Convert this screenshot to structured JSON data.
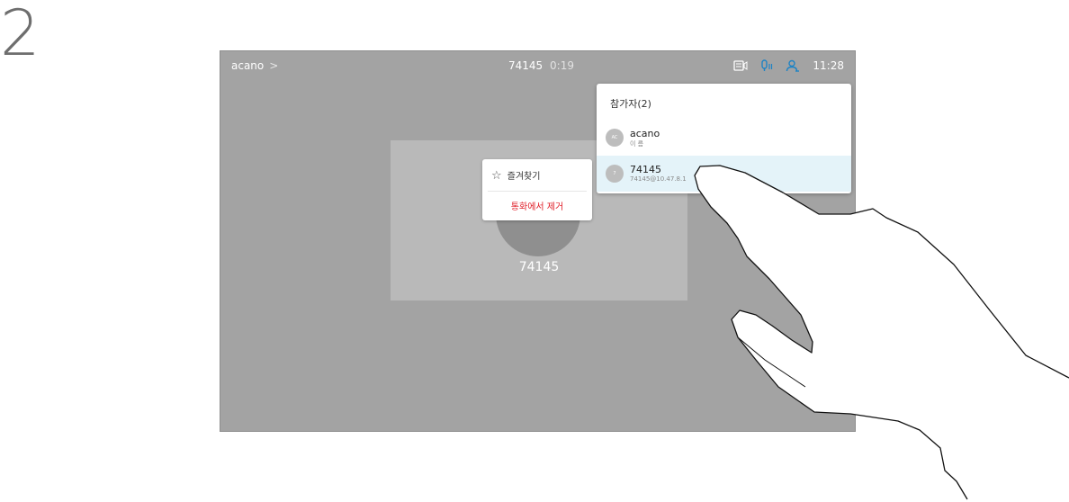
{
  "step_number": "2",
  "topbar": {
    "meeting_name": "acano",
    "chevron": ">",
    "call_number": "74145",
    "call_timer": "0:19",
    "clock": "11:28",
    "icons": [
      "layout-icon",
      "mic-icon",
      "participants-icon"
    ],
    "accent_color": "#1f84c5"
  },
  "tile": {
    "name": "74145"
  },
  "context_menu": {
    "favorite_label": "즐겨찾기",
    "remove_label": "통화에서 제거"
  },
  "participants": {
    "title": "참가자(2)",
    "items": [
      {
        "avatar": "AC",
        "name": "acano",
        "sub": "이 름"
      },
      {
        "avatar": "7",
        "name": "74145",
        "sub": "74145@10.47.8.1"
      }
    ]
  }
}
